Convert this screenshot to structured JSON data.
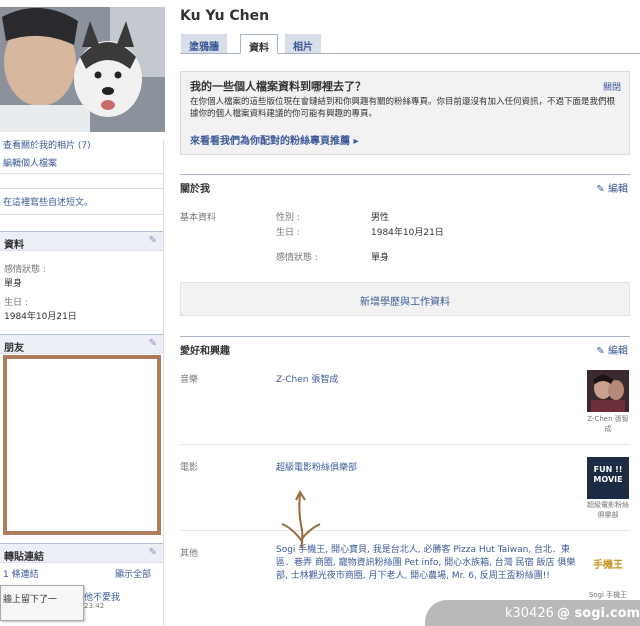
{
  "profile": {
    "name": "Ku Yu Chen"
  },
  "tabs": [
    {
      "label": "塗鴉牆",
      "active": false
    },
    {
      "label": "資料",
      "active": true
    },
    {
      "label": "相片",
      "active": false
    }
  ],
  "left": {
    "photo_links": [
      "查看關於我的相片 (7)",
      "編輯個人檔案"
    ],
    "status_prompt": "在這裡寫些自述短文。",
    "info_box": {
      "title": "資料",
      "fields": [
        {
          "label": "感情狀態 :",
          "value": "單身"
        },
        {
          "label": "生日 :",
          "value": "1984年10月21日"
        }
      ]
    },
    "friends_box": {
      "title": "朋友"
    },
    "links_box": {
      "title": "轉貼連結",
      "count": "1 條連結",
      "show_all": "顯示全部",
      "item_text": "他不愛我",
      "item_time": "23:42"
    },
    "popup_text": "牆上留下了一"
  },
  "notice": {
    "title": "我的一些個人檔案資料到哪裡去了？",
    "close": "關閉",
    "body": "在你個人檔案的這些版位現在會鏈結到和你興趣有關的粉絲專頁。你目前還沒有加入任何資訊，不過下面是我們根據你的個人檔案資料建議的你可能有興趣的專頁。",
    "link": "來看看我們為你配對的粉絲專頁推薦 ▸"
  },
  "about": {
    "title": "關於我",
    "edit": "編輯",
    "group_label": "基本資料",
    "rows": [
      {
        "label": "性別 :",
        "value": "男性"
      },
      {
        "label": "生日 :",
        "value": "1984年10月21日"
      },
      {
        "label": "感情狀態 :",
        "value": "單身"
      }
    ],
    "add_edu": "新增學歷與工作資料"
  },
  "interests": {
    "title": "愛好和興趣",
    "edit": "編輯",
    "items": [
      {
        "label": "音樂",
        "value": "Z-Chen 張智成",
        "thumb_caption": "Z-Chen 張智成"
      },
      {
        "label": "電影",
        "value": "超級電影粉絲俱樂部",
        "thumb_caption": "超級電影粉絲俱樂部",
        "thumb_text": "FUN !! MOVIE"
      },
      {
        "label": "其他",
        "value": "Sogi 手機王, 開心寶貝, 我是台北人, 必勝客 Pizza Hut Taiwan, 台北．東區．巷弄 商圈, 寵物資訊粉絲團 Pet info, 開心水族箱, 台灣 民宿 飯店 俱樂部, 士林觀光夜市商圈, 月下老人, 開心農場, Mr. 6, 反周王盃粉絲團!!",
        "thumb_caption": "Sogi 手機王",
        "thumb_text": "手機王"
      }
    ]
  },
  "watermark": {
    "id": "k30426",
    "site": "@ sogi.com.tw"
  },
  "colors": {
    "link": "#3b5998",
    "header_bg": "#eceff5",
    "tab_inactive": "#d8dfea",
    "friends_border": "#b07a5c"
  }
}
